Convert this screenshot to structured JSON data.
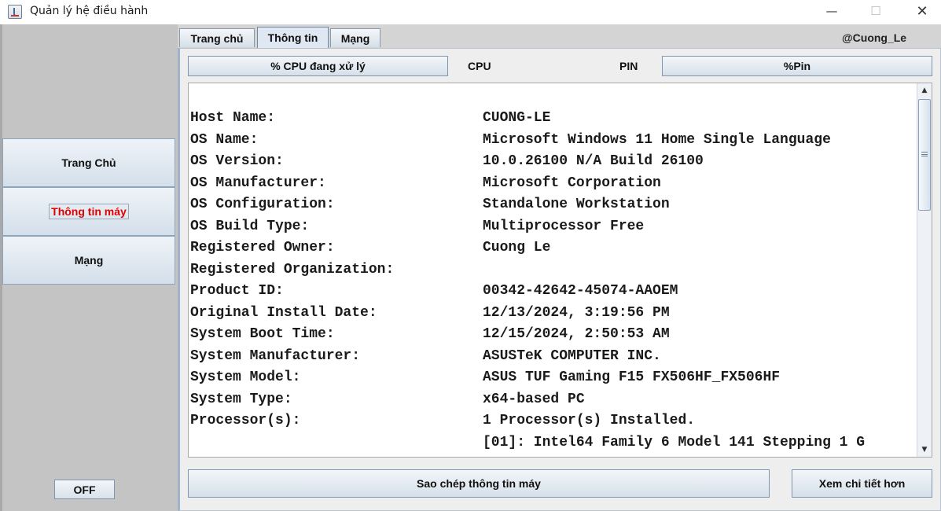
{
  "window": {
    "title": "Quản lý hệ điều hành",
    "minimize_icon": "—",
    "maximize_icon": "☐",
    "close_icon": "✕"
  },
  "sidebar": {
    "items": [
      {
        "label": "Trang Chủ"
      },
      {
        "label": "Thông tin máy",
        "active": true,
        "color": "#e00000"
      },
      {
        "label": "Mạng"
      }
    ],
    "off_label": "OFF"
  },
  "tabs": [
    {
      "label": "Trang chủ"
    },
    {
      "label": "Thông tin",
      "selected": true
    },
    {
      "label": "Mạng"
    }
  ],
  "user_tag": "@Cuong_Le",
  "toolbar": {
    "cpu_button": "% CPU đang xử lý",
    "cpu_label": "CPU",
    "pin_label": "PIN",
    "pin_button": "%Pin"
  },
  "system_info": [
    {
      "key": "Host Name:",
      "value": "CUONG-LE"
    },
    {
      "key": "OS Name:",
      "value": "Microsoft Windows 11 Home Single Language"
    },
    {
      "key": "OS Version:",
      "value": "10.0.26100 N/A Build 26100"
    },
    {
      "key": "OS Manufacturer:",
      "value": "Microsoft Corporation"
    },
    {
      "key": "OS Configuration:",
      "value": "Standalone Workstation"
    },
    {
      "key": "OS Build Type:",
      "value": "Multiprocessor Free"
    },
    {
      "key": "Registered Owner:",
      "value": "Cuong Le"
    },
    {
      "key": "Registered Organization:",
      "value": ""
    },
    {
      "key": "Product ID:",
      "value": "00342-42642-45074-AAOEM"
    },
    {
      "key": "Original Install Date:",
      "value": "12/13/2024, 3:19:56 PM"
    },
    {
      "key": "System Boot Time:",
      "value": "12/15/2024, 2:50:53 AM"
    },
    {
      "key": "System Manufacturer:",
      "value": "ASUSTeK COMPUTER INC."
    },
    {
      "key": "System Model:",
      "value": "ASUS TUF Gaming F15 FX506HF_FX506HF"
    },
    {
      "key": "System Type:",
      "value": "x64-based PC"
    },
    {
      "key": "Processor(s):",
      "value": "1 Processor(s) Installed."
    },
    {
      "key": "",
      "value": "[01]: Intel64 Family 6 Model 141 Stepping 1 G"
    }
  ],
  "scrollbar": {
    "up_icon": "▲",
    "down_icon": "▼"
  },
  "actions": {
    "copy_button": "Sao chép thông tin máy",
    "more_button": "Xem chi tiết hơn"
  }
}
